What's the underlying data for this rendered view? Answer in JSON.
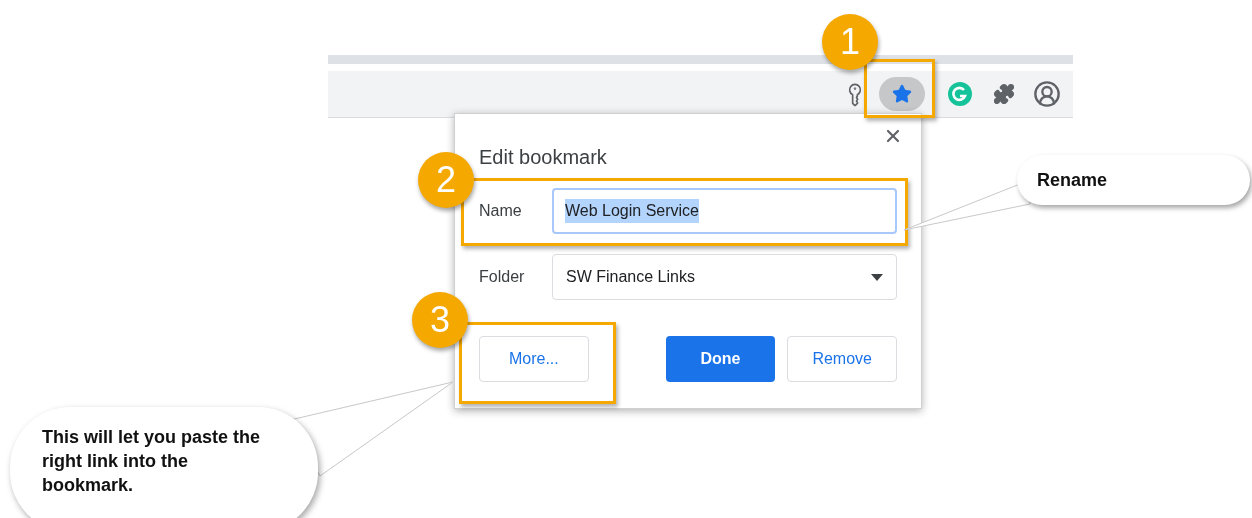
{
  "toolbar": {
    "bookmark_star": {
      "bookmarked": true
    }
  },
  "dialog": {
    "title": "Edit bookmark",
    "fields": [
      {
        "kind": "text",
        "label": "Name",
        "value": "Web Login Service",
        "focused": true,
        "text_selected": true
      },
      {
        "kind": "select",
        "label": "Folder",
        "value": "SW Finance Links"
      }
    ],
    "buttons": [
      {
        "label": "More...",
        "primary": false
      },
      {
        "label": "Done",
        "primary": true
      },
      {
        "label": "Remove",
        "primary": false
      }
    ]
  },
  "annotations": {
    "markers": [
      {
        "label": "1"
      },
      {
        "label": "2"
      },
      {
        "label": "3"
      }
    ],
    "callouts": [
      {
        "text": "Rename"
      },
      {
        "text": "This will let you paste the right link into the bookmark."
      }
    ]
  }
}
